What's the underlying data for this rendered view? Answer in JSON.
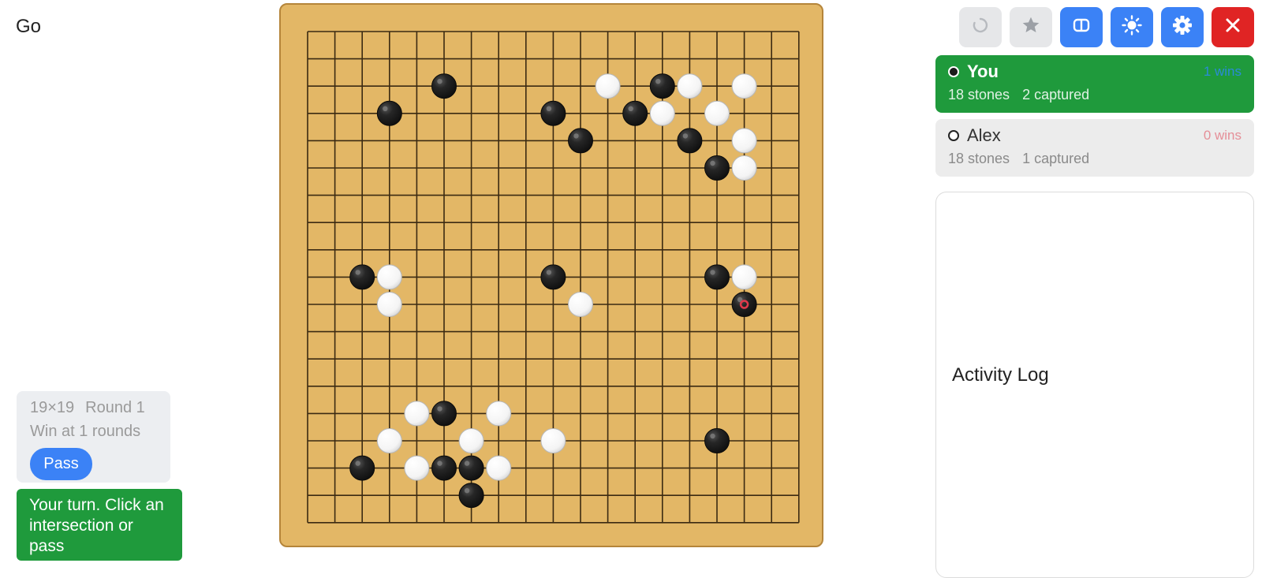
{
  "app": {
    "title": "Go"
  },
  "toolbar": {
    "buttons": [
      {
        "name": "refresh-icon",
        "style": "grey"
      },
      {
        "name": "star-icon",
        "style": "grey"
      },
      {
        "name": "layout-icon",
        "style": "blue"
      },
      {
        "name": "brightness-icon",
        "style": "blue"
      },
      {
        "name": "gear-icon",
        "style": "blue"
      },
      {
        "name": "close-icon",
        "style": "red"
      }
    ]
  },
  "players": [
    {
      "name": "You",
      "wins": "1 wins",
      "stones": "18 stones",
      "captured": "2 captured",
      "color": "black",
      "active": true
    },
    {
      "name": "Alex",
      "wins": "0 wins",
      "stones": "18 stones",
      "captured": "1 captured",
      "color": "white",
      "active": false
    }
  ],
  "activity_log": {
    "title": "Activity Log"
  },
  "info": {
    "board_size": "19×19",
    "round": "Round 1",
    "win_condition": "Win at 1 rounds"
  },
  "pass_button": {
    "label": "Pass"
  },
  "status": {
    "message": "Your turn. Click an intersection or pass"
  },
  "board": {
    "size": 19,
    "last_move": {
      "col": 16,
      "row": 10
    },
    "stones": [
      {
        "color": "black",
        "col": 5,
        "row": 2
      },
      {
        "color": "black",
        "col": 3,
        "row": 3
      },
      {
        "color": "black",
        "col": 9,
        "row": 3
      },
      {
        "color": "black",
        "col": 10,
        "row": 4
      },
      {
        "color": "white",
        "col": 11,
        "row": 2
      },
      {
        "color": "black",
        "col": 13,
        "row": 2
      },
      {
        "color": "white",
        "col": 14,
        "row": 2
      },
      {
        "color": "white",
        "col": 16,
        "row": 2
      },
      {
        "color": "black",
        "col": 12,
        "row": 3
      },
      {
        "color": "white",
        "col": 13,
        "row": 3
      },
      {
        "color": "white",
        "col": 15,
        "row": 3
      },
      {
        "color": "black",
        "col": 14,
        "row": 4
      },
      {
        "color": "white",
        "col": 16,
        "row": 4
      },
      {
        "color": "black",
        "col": 15,
        "row": 5
      },
      {
        "color": "white",
        "col": 16,
        "row": 5
      },
      {
        "color": "black",
        "col": 2,
        "row": 9
      },
      {
        "color": "white",
        "col": 3,
        "row": 9
      },
      {
        "color": "white",
        "col": 3,
        "row": 10
      },
      {
        "color": "black",
        "col": 9,
        "row": 9
      },
      {
        "color": "white",
        "col": 10,
        "row": 10
      },
      {
        "color": "black",
        "col": 15,
        "row": 9
      },
      {
        "color": "white",
        "col": 16,
        "row": 9
      },
      {
        "color": "black",
        "col": 16,
        "row": 10
      },
      {
        "color": "white",
        "col": 4,
        "row": 14
      },
      {
        "color": "black",
        "col": 5,
        "row": 14
      },
      {
        "color": "white",
        "col": 7,
        "row": 14
      },
      {
        "color": "white",
        "col": 3,
        "row": 15
      },
      {
        "color": "white",
        "col": 6,
        "row": 15
      },
      {
        "color": "white",
        "col": 9,
        "row": 15
      },
      {
        "color": "black",
        "col": 15,
        "row": 15
      },
      {
        "color": "black",
        "col": 2,
        "row": 16
      },
      {
        "color": "white",
        "col": 4,
        "row": 16
      },
      {
        "color": "black",
        "col": 5,
        "row": 16
      },
      {
        "color": "black",
        "col": 6,
        "row": 16
      },
      {
        "color": "white",
        "col": 7,
        "row": 16
      },
      {
        "color": "black",
        "col": 6,
        "row": 17
      }
    ]
  }
}
